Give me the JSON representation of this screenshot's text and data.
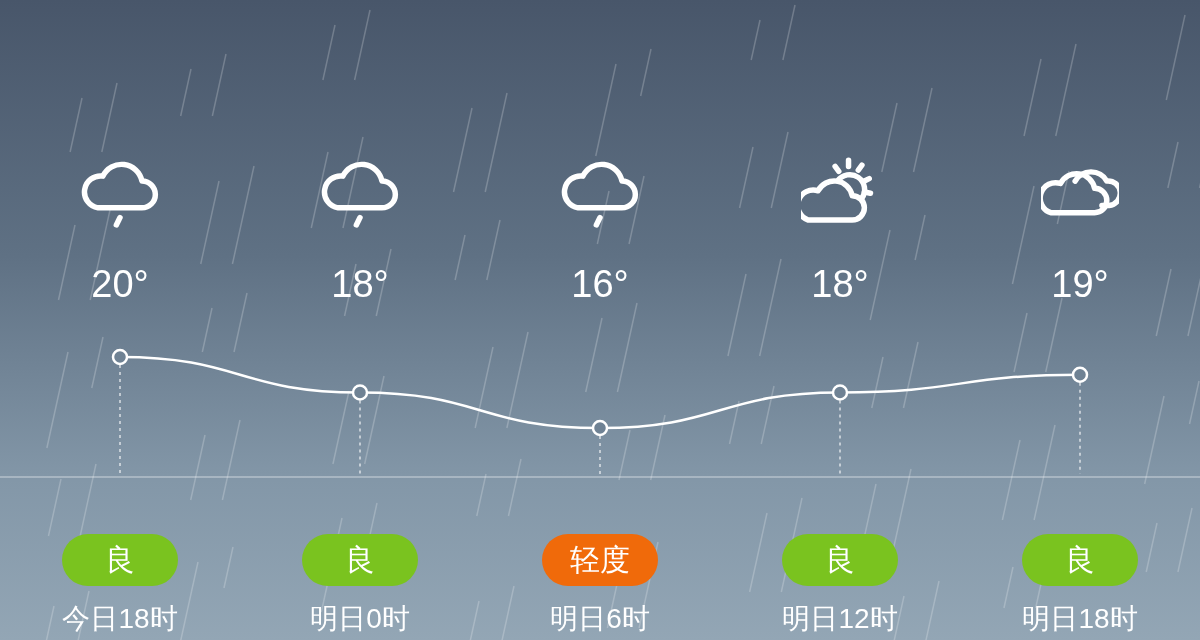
{
  "forecast": [
    {
      "kind": "rain",
      "temperature": "20°",
      "air_quality": "良",
      "color": "#7ac31f",
      "time": "今日18时"
    },
    {
      "kind": "rain",
      "temperature": "18°",
      "air_quality": "良",
      "color": "#7ac31f",
      "time": "明日0时"
    },
    {
      "kind": "rain",
      "temperature": "16°",
      "air_quality": "轻度",
      "color": "#f06a0a",
      "time": "明日6时"
    },
    {
      "kind": "partly-cloudy",
      "temperature": "18°",
      "air_quality": "良",
      "color": "#7ac31f",
      "time": "明日12时"
    },
    {
      "kind": "cloudy",
      "temperature": "19°",
      "air_quality": "良",
      "color": "#7ac31f",
      "time": "明日18时"
    }
  ]
}
